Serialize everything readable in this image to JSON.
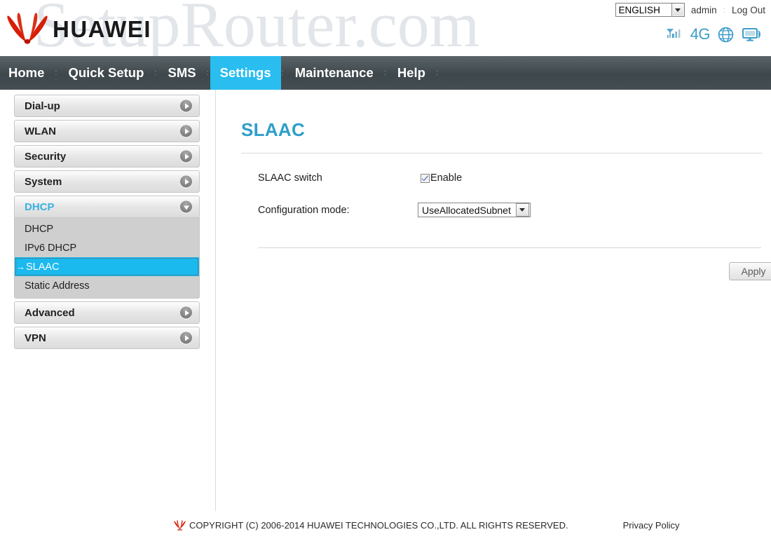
{
  "header": {
    "brand": "HUAWEI",
    "watermark": "SetupRouter.com",
    "language": "ENGLISH",
    "user": "admin",
    "logout": "Log Out",
    "separator": ":",
    "network_type": "4G",
    "icons": {
      "signal": "signal-bars-icon",
      "network": "4g-label",
      "globe": "globe-icon",
      "device": "monitor-wifi-icon",
      "lang_caret": "chevron-down-icon"
    }
  },
  "nav": {
    "items": [
      {
        "label": "Home",
        "active": false
      },
      {
        "label": "Quick Setup",
        "active": false
      },
      {
        "label": "SMS",
        "active": false
      },
      {
        "label": "Settings",
        "active": true
      },
      {
        "label": "Maintenance",
        "active": false
      },
      {
        "label": "Help",
        "active": false
      }
    ],
    "separator": ":"
  },
  "sidebar": {
    "groups": [
      {
        "label": "Dial-up",
        "expanded": false,
        "items": []
      },
      {
        "label": "WLAN",
        "expanded": false,
        "items": []
      },
      {
        "label": "Security",
        "expanded": false,
        "items": []
      },
      {
        "label": "System",
        "expanded": false,
        "items": []
      },
      {
        "label": "DHCP",
        "expanded": true,
        "items": [
          {
            "label": "DHCP",
            "selected": false
          },
          {
            "label": "IPv6 DHCP",
            "selected": false
          },
          {
            "label": "SLAAC",
            "selected": true
          },
          {
            "label": "Static Address",
            "selected": false
          }
        ]
      },
      {
        "label": "Advanced",
        "expanded": false,
        "items": []
      },
      {
        "label": "VPN",
        "expanded": false,
        "items": []
      }
    ],
    "selected_arrow": "→"
  },
  "main": {
    "title": "SLAAC",
    "rows": [
      {
        "label": "SLAAC switch",
        "control": "checkbox",
        "checkbox_label": "Enable",
        "checked": true
      },
      {
        "label": "Configuration mode:",
        "control": "select",
        "value": "UseAllocatedSubnet"
      }
    ],
    "apply_label": "Apply"
  },
  "footer": {
    "copyright": "COPYRIGHT (C) 2006-2014 HUAWEI TECHNOLOGIES CO.,LTD. ALL RIGHTS RESERVED.",
    "privacy": "Privacy Policy"
  },
  "colors": {
    "accent": "#29bdf0",
    "title": "#2e9fca",
    "nav_bg": "#454e52",
    "brand_red": "#d81e06",
    "selected_item": "#1ab9ee"
  }
}
